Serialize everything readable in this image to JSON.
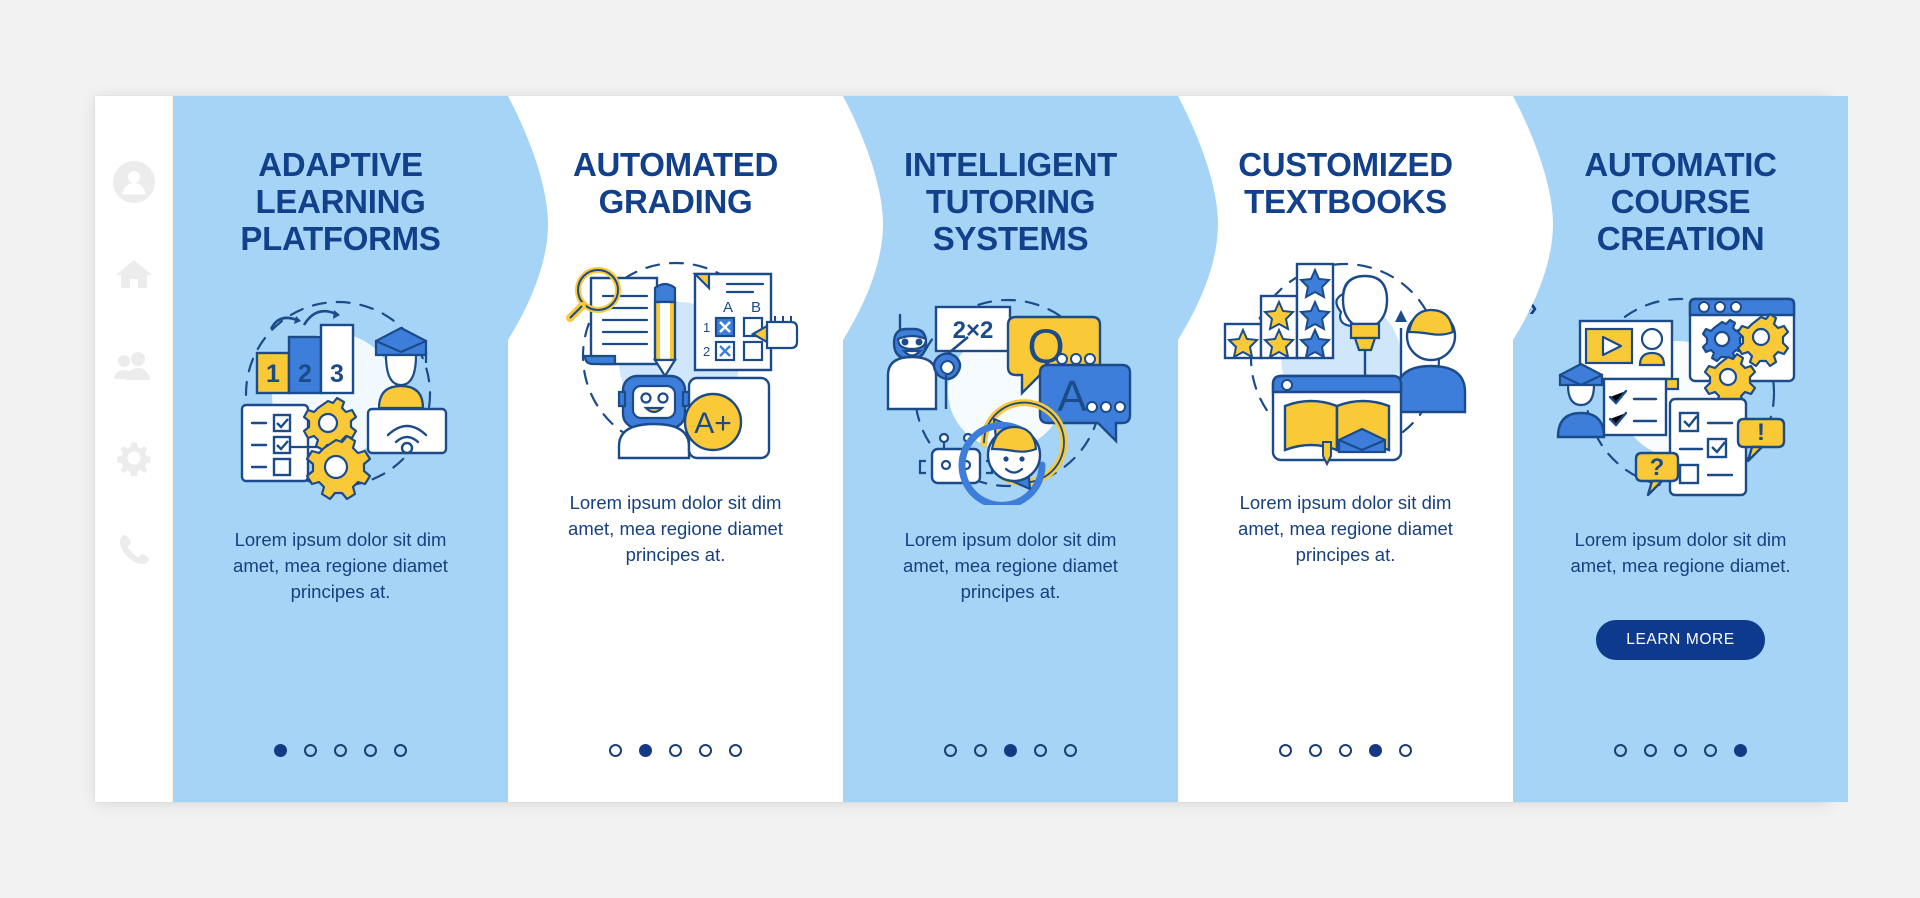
{
  "app": {
    "background": "#f2f2f2",
    "panel_background": "#ffffff",
    "accent_blue": "#a5d4f7",
    "title_navy": "#13408a",
    "button_navy": "#0d3a8c",
    "illustration_yellow": "#f9c938",
    "illustration_blue": "#3d7edb"
  },
  "sidebar": {
    "items": [
      {
        "icon": "user-avatar-icon",
        "label": "Profile"
      },
      {
        "icon": "home-icon",
        "label": "Home"
      },
      {
        "icon": "people-group-icon",
        "label": "Community"
      },
      {
        "icon": "gear-icon",
        "label": "Settings"
      },
      {
        "icon": "phone-icon",
        "label": "Contact"
      }
    ]
  },
  "separator": {
    "glyph": "»",
    "count": 4
  },
  "cards": [
    {
      "id": "adaptive-learning-platforms",
      "theme": "blue",
      "title": "ADAPTIVE LEARNING PLATFORMS",
      "description": "Lorem ipsum dolor sit dim amet, mea regione diamet principes at.",
      "illustration": "podium-ranking-graduate-gears-wifi",
      "illustration_labels": [
        "1",
        "2",
        "3"
      ],
      "dots": {
        "total": 5,
        "active": 1
      },
      "button": null
    },
    {
      "id": "automated-grading",
      "theme": "white",
      "title": "AUTOMATED GRADING",
      "description": "Lorem ipsum dolor sit dim amet, mea regione diamet principes at.",
      "illustration": "magnifier-test-sheet-robot-a-plus",
      "illustration_labels": [
        "A",
        "B",
        "1",
        "2",
        "A+"
      ],
      "dots": {
        "total": 5,
        "active": 2
      },
      "button": null
    },
    {
      "id": "intelligent-tutoring-systems",
      "theme": "blue",
      "title": "INTELLIGENT TUTORING SYSTEMS",
      "description": "Lorem ipsum dolor sit dim amet, mea regione diamet principes at.",
      "illustration": "robot-teacher-qa-bubbles-exchange",
      "illustration_labels": [
        "2×2",
        "Q",
        "A"
      ],
      "dots": {
        "total": 5,
        "active": 3
      },
      "button": null
    },
    {
      "id": "customized-textbooks",
      "theme": "white",
      "title": "CUSTOMIZED TEXTBOOKS",
      "description": "Lorem ipsum dolor sit dim amet, mea regione diamet principes at.",
      "illustration": "star-bars-brain-bulb-person-book",
      "illustration_labels": [],
      "dots": {
        "total": 5,
        "active": 4
      },
      "button": null
    },
    {
      "id": "automatic-course-creation",
      "theme": "blue",
      "title": "AUTOMATIC COURSE CREATION",
      "description": "Lorem ipsum dolor sit dim amet, mea regione diamet.",
      "illustration": "video-graduate-checklist-browser-gears",
      "illustration_labels": [
        "?",
        "!"
      ],
      "dots": {
        "total": 5,
        "active": 5
      },
      "button": {
        "label": "LEARN MORE"
      }
    }
  ]
}
